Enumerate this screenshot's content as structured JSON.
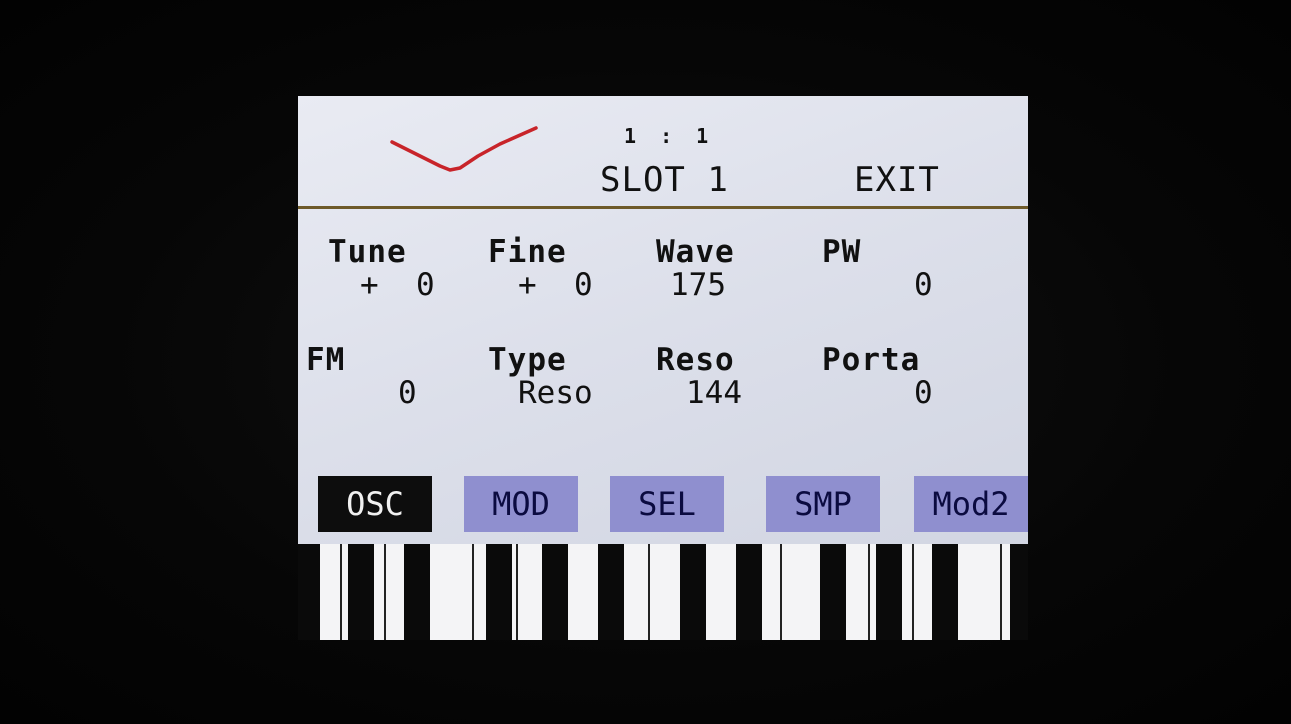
{
  "header": {
    "position": "1 : 1",
    "slot_label": "SLOT 1",
    "exit_label": "EXIT",
    "wave_icon": "waveform-icon",
    "wave_color": "#c8242a"
  },
  "params": [
    {
      "label": "Tune",
      "value": "+  0"
    },
    {
      "label": "Fine",
      "value": "+  0"
    },
    {
      "label": "Wave",
      "value": "175"
    },
    {
      "label": "PW",
      "value": "0"
    },
    {
      "label": "FM",
      "value": "0"
    },
    {
      "label": "Type",
      "value": "Reso"
    },
    {
      "label": "Reso",
      "value": "144"
    },
    {
      "label": "Porta",
      "value": "0"
    }
  ],
  "tabs": [
    {
      "label": "OSC",
      "active": true
    },
    {
      "label": "MOD",
      "active": false
    },
    {
      "label": "SEL",
      "active": false
    },
    {
      "label": "SMP",
      "active": false
    },
    {
      "label": "Mod2",
      "active": false
    }
  ],
  "colors": {
    "screen_bg": "#dcdfea",
    "tab_inactive": "#8f8fcf",
    "tab_active": "#0d0d0d",
    "header_line": "#6e5a2a"
  }
}
